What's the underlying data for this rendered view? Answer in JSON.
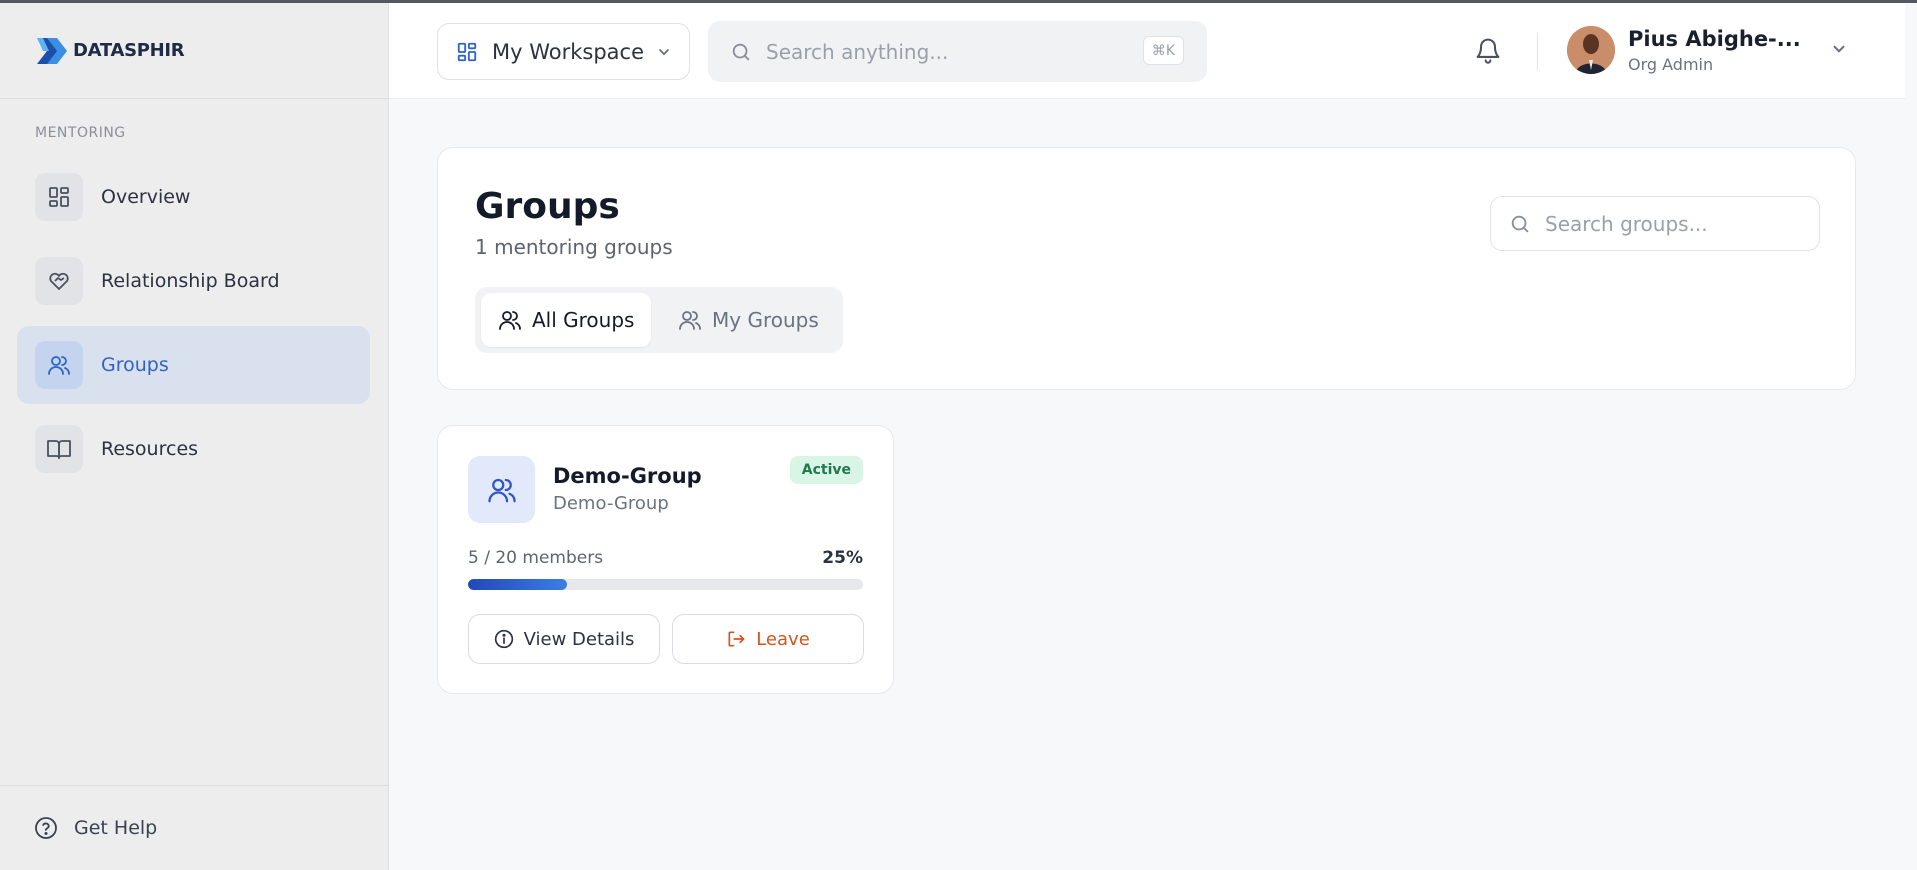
{
  "brand": {
    "name": "DATASPHIR"
  },
  "sidebar": {
    "section_label": "MENTORING",
    "items": [
      {
        "label": "Overview",
        "icon": "grid-icon"
      },
      {
        "label": "Relationship Board",
        "icon": "heart-handshake-icon"
      },
      {
        "label": "Groups",
        "icon": "users-icon",
        "active": true
      },
      {
        "label": "Resources",
        "icon": "book-icon"
      }
    ],
    "help_label": "Get Help"
  },
  "header": {
    "workspace_label": "My Workspace",
    "search_placeholder": "Search anything...",
    "search_shortcut": "⌘K",
    "user": {
      "name": "Pius Abighe-...",
      "role": "Org Admin"
    }
  },
  "main": {
    "title": "Groups",
    "subtitle": "1 mentoring groups",
    "tabs": [
      {
        "label": "All Groups",
        "active": true
      },
      {
        "label": "My Groups",
        "active": false
      }
    ],
    "search_placeholder": "Search groups..."
  },
  "groups": [
    {
      "name": "Demo-Group",
      "description": "Demo-Group",
      "status": "Active",
      "members_text": "5 / 20 members",
      "percent_text": "25%",
      "progress": 0.25,
      "view_label": "View Details",
      "leave_label": "Leave"
    }
  ],
  "colors": {
    "accent": "#2f63c8",
    "active_badge_bg": "#d8f5e6",
    "active_badge_text": "#1f7a4d",
    "leave_text": "#d2541f"
  }
}
